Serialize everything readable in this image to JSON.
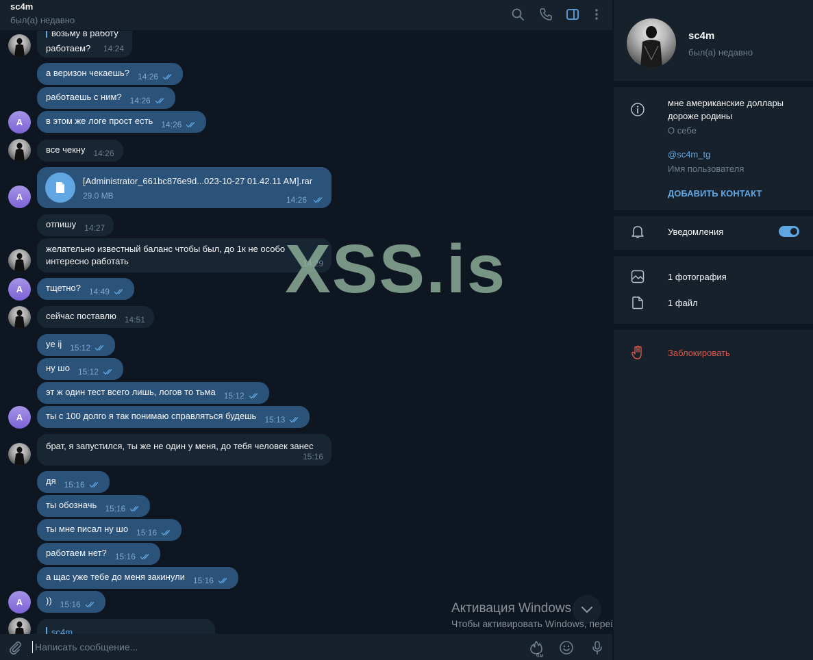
{
  "header": {
    "title": "sc4m",
    "status": "был(а) недавно"
  },
  "messages": {
    "m0_text": "возьму в работу",
    "m1_text": "работаем?",
    "m1_time": "14:24",
    "m2_text": "а веризон чекаешь?",
    "m2_time": "14:26",
    "m3_text": "работаешь с ним?",
    "m3_time": "14:26",
    "m4_text": "в этом же логе прост есть",
    "m4_time": "14:26",
    "m5_text": "все чекну",
    "m5_time": "14:26",
    "file_name": "[Administrator_661bc876e9d...023-10-27 01.42.11 AM].rar",
    "file_size": "29.0 MB",
    "file_time": "14:26",
    "m6_text": "отпишу",
    "m6_time": "14:27",
    "m7_line1": "желательно известный баланс чтобы был, до 1к не особо",
    "m7_line2": "интересно работать",
    "m7_time": "14:29",
    "m8_text": "тщетно?",
    "m8_time": "14:49",
    "m9_text": "сейчас поставлю",
    "m9_time": "14:51",
    "m10_text": "ye ij",
    "m10_time": "15:12",
    "m11_text": "ну шо",
    "m11_time": "15:12",
    "m12_text": "эт ж один тест всего лишь, логов то тьма",
    "m12_time": "15:12",
    "m13_text": "ты с 100 долго я так понимаю справляться будешь",
    "m13_time": "15:13",
    "m14_text": "брат, я запустился, ты же не один у меня, до тебя человек занес",
    "m14_time": "15:16",
    "m15_text": "дя",
    "m15_time": "15:16",
    "m16_text": "ты обозначь",
    "m16_time": "15:16",
    "m17_text": "ты мне писал ну шо",
    "m17_time": "15:16",
    "m18_text": "работаем нет?",
    "m18_time": "15:16",
    "m19_text": "а щас уже тебе до меня закинули",
    "m19_time": "15:16",
    "m20_text": "))",
    "m20_time": "15:16",
    "m21_reply": "sc4m"
  },
  "avatar_letter": "A",
  "watermark": "XSS.is",
  "windows_activation": {
    "title": "Активация Windows",
    "subtitle": "Чтобы активировать Windows, перейдите в раздел \"Параметры\"."
  },
  "composer": {
    "placeholder": "Написать сообщение...",
    "timer_label": "6м"
  },
  "side_panel": {
    "name": "sc4m",
    "status": "был(а) недавно",
    "bio_line1": "мне американские доллары",
    "bio_line2": "дороже родины",
    "bio_label": "О себе",
    "username": "@sc4m_tg",
    "username_label": "Имя пользователя",
    "add_contact": "ДОБАВИТЬ КОНТАКТ",
    "notifications": "Уведомления",
    "notifications_on": true,
    "photos": "1 фотография",
    "files": "1 файл",
    "block": "Заблокировать"
  },
  "colors": {
    "bg": "#0e1621",
    "panel": "#17212b",
    "outgoing": "#2b5278",
    "incoming": "#182533",
    "accent": "#5fa6e3",
    "danger": "#e0584b"
  },
  "icons": [
    "search-icon",
    "phone-icon",
    "sidebar-toggle-icon",
    "more-vertical-icon",
    "info-icon",
    "bell-icon",
    "photo-icon",
    "file-icon",
    "hand-block-icon",
    "paperclip-icon",
    "fire-timer-icon",
    "emoji-icon",
    "microphone-icon",
    "chevron-down-icon",
    "document-icon",
    "double-check-icon"
  ]
}
